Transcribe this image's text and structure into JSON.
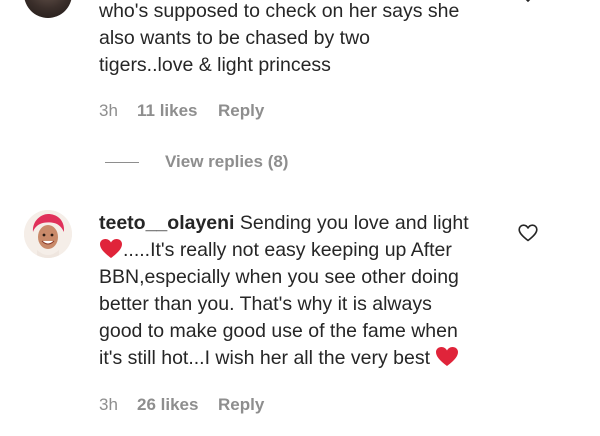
{
  "comment1": {
    "lines": [
      "who's supposed to check on her says she",
      "also wants to be chased by two",
      "tigers..love & light princess"
    ],
    "time": "3h",
    "likes": "11 likes",
    "reply_label": "Reply",
    "view_replies": "View replies (8)"
  },
  "comment2": {
    "username": "teeto__olayeni",
    "line1_text": " Sending you love and light",
    "line2_text": ".....It's really not easy keeping up After",
    "lines_middle": [
      "BBN,especially when you see other doing",
      "better than you. That's why it is always",
      "good to make good use of the fame when"
    ],
    "last_line_text": "it's still hot...I wish her all the very best ",
    "time": "3h",
    "likes": "26 likes",
    "reply_label": "Reply"
  },
  "icons": {
    "like": "heart-outline-icon",
    "emoji": "red-heart-emoji"
  },
  "colors": {
    "text": "#262626",
    "secondary": "#8e8e8e",
    "emoji_red": "#e0243a",
    "avatar_accent": "#e0305a"
  }
}
